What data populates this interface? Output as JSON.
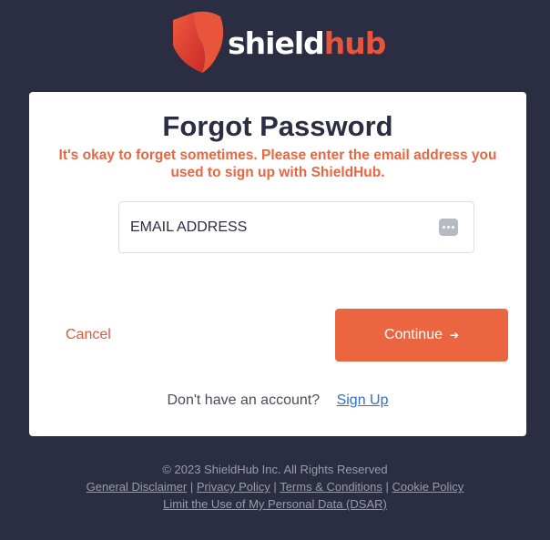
{
  "brand": {
    "name_part1": "shield",
    "name_part2": "hub",
    "logo_icon": "shield-icon",
    "colors": {
      "primary": "#ec6541",
      "background": "#2b2d42",
      "link": "#2f6fd6"
    }
  },
  "form": {
    "title": "Forgot Password",
    "subtitle": "It's okay to forget sometimes. Please enter the email address you used to sign up with ShieldHub.",
    "email_placeholder": "EMAIL ADDRESS",
    "email_value": "",
    "autofill_icon": "dots-icon",
    "cancel_label": "Cancel",
    "continue_label": "Continue",
    "continue_icon": "arrow-right-icon",
    "signup_prompt": "Don't have an account?",
    "signup_link": "Sign Up"
  },
  "footer": {
    "copyright": "© 2023 ShieldHub Inc. All Rights Reserved",
    "links": [
      "General Disclaimer",
      "Privacy Policy",
      "Terms & Conditions",
      "Cookie Policy"
    ],
    "separator": "|",
    "dsar_link": "Limit the Use of My Personal Data (DSAR)"
  }
}
